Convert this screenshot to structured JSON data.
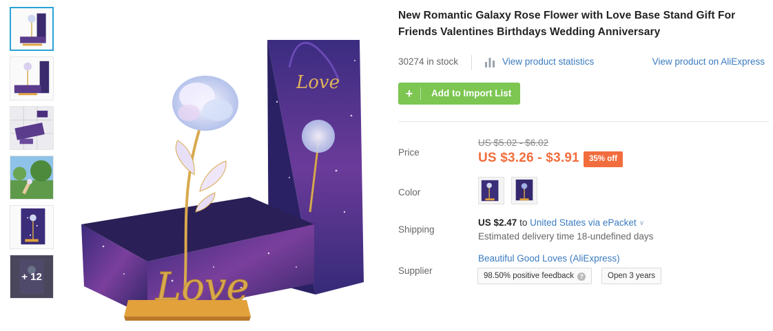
{
  "product": {
    "title": "New Romantic Galaxy Rose Flower with Love Base Stand Gift For Friends Valentines Birthdays Wedding Anniversary"
  },
  "gallery": {
    "more_label": "+ 12"
  },
  "meta": {
    "stock": "30274 in stock",
    "stats_link": "View product statistics",
    "ali_link": "View product on AliExpress",
    "stats_icon": "bar-chart-icon"
  },
  "actions": {
    "import_label": "Add to Import List",
    "import_icon": "plus-icon",
    "import_color": "#7cc651"
  },
  "price": {
    "label": "Price",
    "original": "US $5.02 - $6.02",
    "sale": "US $3.26 - $3.91",
    "discount": "35% off",
    "accent_color": "#f26d3d"
  },
  "color": {
    "label": "Color"
  },
  "shipping": {
    "label": "Shipping",
    "price": "US $2.47",
    "to": "to",
    "destination": "United States via ePacket",
    "chevron": "∨",
    "eta": "Estimated delivery time 18-undefined days"
  },
  "supplier": {
    "label": "Supplier",
    "name": "Beautiful Good Loves (AliExpress)",
    "feedback": "98.50% positive feedback",
    "help": "?",
    "open": "Open 3 years"
  },
  "link_color": "#3a7bbf"
}
